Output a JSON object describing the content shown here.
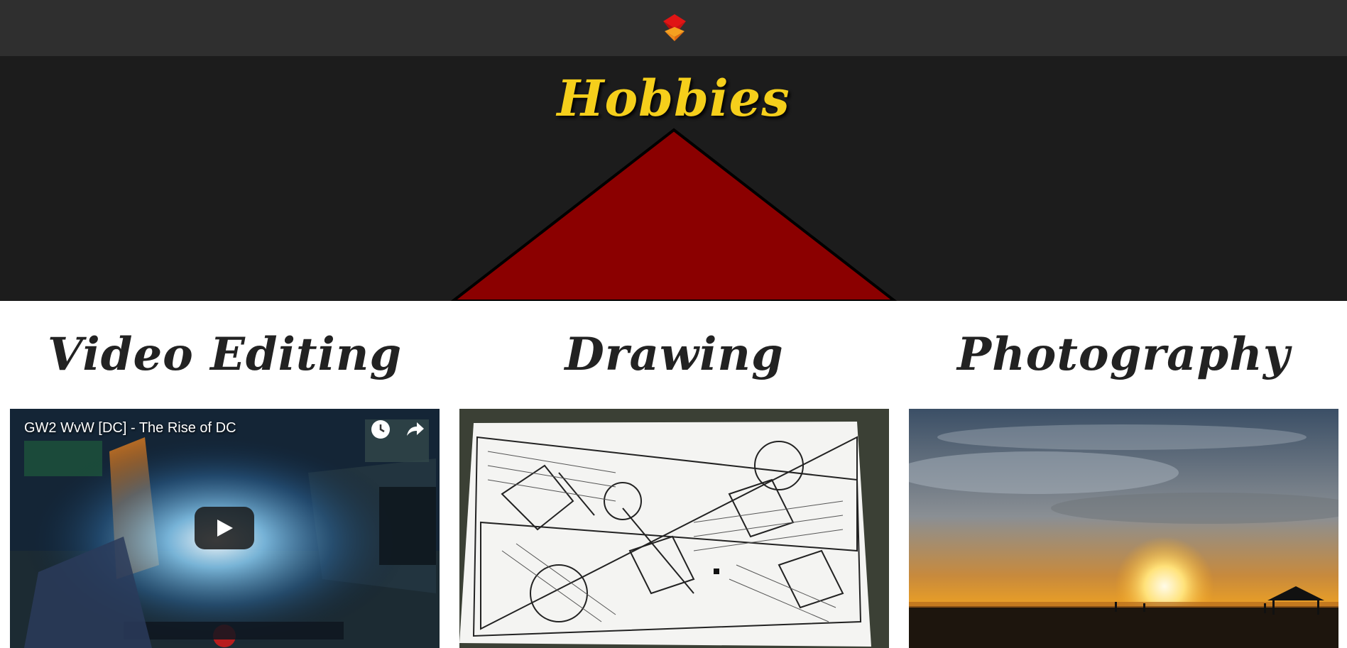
{
  "header": {
    "logo_icon": "red-orange-cube-logo",
    "colors": {
      "bar": "#2f2f2f",
      "logo_top": "#e01515",
      "logo_bottom": "#f28a1a"
    }
  },
  "hero": {
    "title": "Hobbies",
    "colors": {
      "background": "#1c1c1c",
      "title": "#f5cf1b",
      "triangle": "#8b0000"
    }
  },
  "sections": [
    {
      "title": "Video Editing"
    },
    {
      "title": "Drawing"
    },
    {
      "title": "Photography"
    }
  ],
  "video": {
    "title": "GW2 WvW [DC] - The Rise of DC",
    "watch_later_icon": "clock-icon",
    "share_icon": "share-icon",
    "play_icon": "play-icon"
  }
}
